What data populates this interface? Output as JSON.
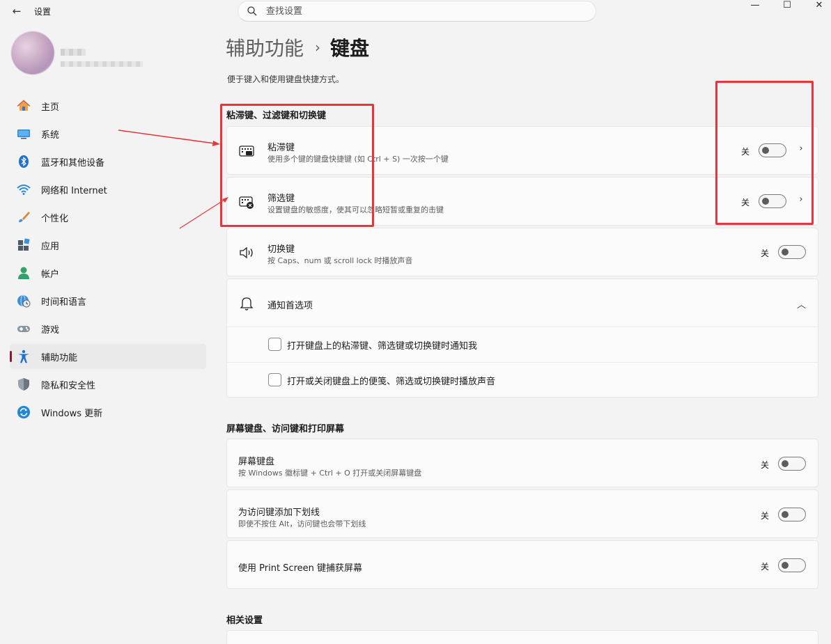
{
  "window": {
    "back_glyph": "←",
    "title": "设置",
    "minimize_glyph": "—",
    "maximize_glyph": "☐",
    "close_glyph": "✕"
  },
  "search": {
    "placeholder": "查找设置"
  },
  "user": {
    "name": "■■",
    "email": "■■■■■■■■■■■■■■"
  },
  "nav": {
    "items": [
      {
        "label": "主页",
        "icon": "home-icon",
        "active": false
      },
      {
        "label": "系统",
        "icon": "system-icon",
        "active": false
      },
      {
        "label": "蓝牙和其他设备",
        "icon": "bluetooth-icon",
        "active": false
      },
      {
        "label": "网络和 Internet",
        "icon": "wifi-icon",
        "active": false
      },
      {
        "label": "个性化",
        "icon": "brush-icon",
        "active": false
      },
      {
        "label": "应用",
        "icon": "apps-icon",
        "active": false
      },
      {
        "label": "帐户",
        "icon": "account-icon",
        "active": false
      },
      {
        "label": "时间和语言",
        "icon": "globe-clock-icon",
        "active": false
      },
      {
        "label": "游戏",
        "icon": "gamepad-icon",
        "active": false
      },
      {
        "label": "辅助功能",
        "icon": "accessibility-icon",
        "active": true
      },
      {
        "label": "隐私和安全性",
        "icon": "shield-icon",
        "active": false
      },
      {
        "label": "Windows 更新",
        "icon": "update-icon",
        "active": false
      }
    ]
  },
  "main": {
    "breadcrumb_parent": "辅助功能",
    "breadcrumb_sep": "›",
    "breadcrumb_current": "键盘",
    "description": "便于键入和使用键盘快捷方式。",
    "section1_title": "粘滞键、过滤键和切换键",
    "sticky": {
      "title": "粘滞键",
      "subtitle": "使用多个键的键盘快捷键 (如 Ctrl + S) 一次按一个键",
      "state": "关",
      "chevron": "›"
    },
    "filter": {
      "title": "筛选键",
      "subtitle": "设置键盘的敏感度，使其可以忽略短暂或重复的击键",
      "state": "关",
      "chevron": "›"
    },
    "toggle_keys": {
      "title": "切换键",
      "subtitle": "按 Caps、num 或 scroll lock 时播放声音",
      "state": "关"
    },
    "notifications": {
      "title": "通知首选项",
      "chevron": "︿",
      "option1": "打开键盘上的粘滞键、筛选键或切换键时通知我",
      "option2": "打开或关闭键盘上的便笺、筛选或切换键时播放声音"
    },
    "section2_title": "屏幕键盘、访问键和打印屏幕",
    "osk": {
      "title": "屏幕键盘",
      "subtitle": "按 Windows 徽标键 + Ctrl + O 打开或关闭屏幕键盘",
      "state": "关"
    },
    "underline": {
      "title": "为访问键添加下划线",
      "subtitle": "即使不按住 Alt，访问键也会带下划线",
      "state": "关"
    },
    "printscreen": {
      "title": "使用 Print Screen 键捕获屏幕",
      "state": "关"
    },
    "section3_title": "相关设置"
  },
  "colors": {
    "annotation": "#e8343a",
    "accent_indicator": "#8a1a30"
  }
}
